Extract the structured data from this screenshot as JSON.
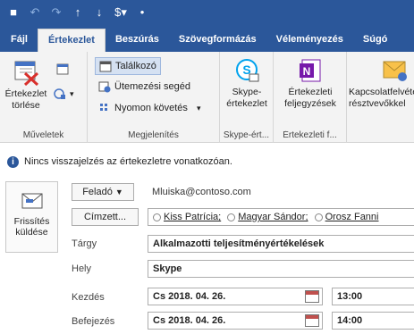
{
  "qat": {
    "icons": [
      "save-icon",
      "undo-icon",
      "redo-icon",
      "up-arrow-icon",
      "down-arrow-icon",
      "dollar-icon",
      "customize-icon"
    ]
  },
  "tabs": [
    {
      "label": "Fájl",
      "active": false
    },
    {
      "label": "Értekezlet",
      "active": true
    },
    {
      "label": "Beszúrás",
      "active": false
    },
    {
      "label": "Szövegformázás",
      "active": false
    },
    {
      "label": "Véleményezés",
      "active": false
    },
    {
      "label": "Súgó",
      "active": false
    }
  ],
  "ribbon": {
    "actions": {
      "label": "Műveletek",
      "delete": "Értekezlet törlése"
    },
    "show": {
      "label": "Megjelenítés",
      "appointment": "Találkozó",
      "scheduling": "Ütemezési segéd",
      "tracking": "Nyomon követés"
    },
    "skype": {
      "label": "Skype-ért...",
      "button": "Skype-értekezlet"
    },
    "notes": {
      "label": "Értekezleti f...",
      "button": "Értekezleti feljegyzések"
    },
    "contact": {
      "button": "Kapcsolatfelvétel a résztvevőkkel"
    }
  },
  "infobar": {
    "text": "Nincs visszajelzés az értekezletre vonatkozóan."
  },
  "form": {
    "send_label": "Frissítés küldése",
    "from_label": "Feladó",
    "from_value": "Mluiska@contoso.com",
    "to_label": "Címzett...",
    "recipients": [
      "Kiss Patrícia;",
      "Magyar Sándor;",
      "Orosz Fanni"
    ],
    "subject_label": "Tárgy",
    "subject_value": "Alkalmazotti teljesítményértékelések",
    "location_label": "Hely",
    "location_value": "Skype",
    "start_label": "Kezdés",
    "start_date": "Cs 2018. 04. 26.",
    "start_time": "13:00",
    "end_label": "Befejezés",
    "end_date": "Cs 2018. 04. 26.",
    "end_time": "14:00"
  }
}
